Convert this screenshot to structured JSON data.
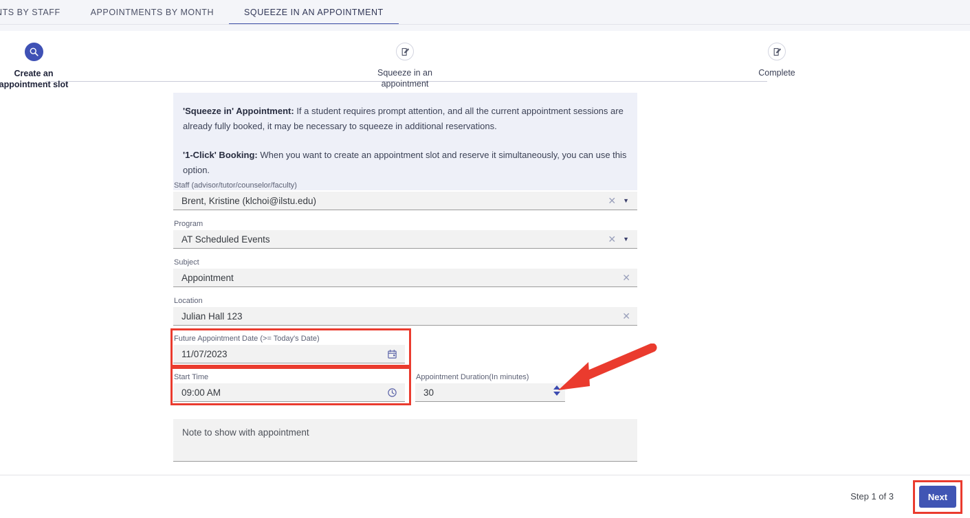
{
  "tabs": [
    {
      "label": "NTS BY STAFF",
      "active": false
    },
    {
      "label": "APPOINTMENTS BY MONTH",
      "active": false
    },
    {
      "label": "SQUEEZE IN AN APPOINTMENT",
      "active": true
    }
  ],
  "stepper": {
    "steps": [
      {
        "caption_line1": "Create an",
        "caption_line2": "appointment slot",
        "icon": "search-icon",
        "active": true
      },
      {
        "caption_line1": "Squeeze in an",
        "caption_line2": "appointment",
        "icon": "edit-document-icon",
        "active": false
      },
      {
        "caption_line1": "Complete",
        "caption_line2": "",
        "icon": "edit-document-icon",
        "active": false
      }
    ]
  },
  "info": {
    "para1_bold": "'Squeeze in' Appointment:",
    "para1_text": " If a student requires prompt attention, and all the current appointment sessions are already fully booked, it may be necessary to squeeze in additional reservations.",
    "para2_bold": "'1-Click' Booking:",
    "para2_text": " When you want to create an appointment slot and reserve it simultaneously, you can use this option."
  },
  "form": {
    "staff": {
      "label": "Staff (advisor/tutor/counselor/faculty)",
      "value": "Brent, Kristine (klchoi@ilstu.edu)"
    },
    "program": {
      "label": "Program",
      "value": "AT Scheduled Events"
    },
    "subject": {
      "label": "Subject",
      "value": "Appointment"
    },
    "location": {
      "label": "Location",
      "value": "Julian Hall 123"
    },
    "future_date": {
      "label": "Future Appointment Date (>= Today's Date)",
      "value": "11/07/2023"
    },
    "start_time": {
      "label": "Start Time",
      "value": "09:00 AM"
    },
    "duration": {
      "label": "Appointment Duration(In minutes)",
      "value": "30"
    },
    "note": {
      "placeholder": "Note to show with appointment",
      "value": ""
    }
  },
  "footer": {
    "step_indicator": "Step 1 of 3",
    "next_label": "Next"
  },
  "colors": {
    "accent": "#3f51b5",
    "button": "#4055b4",
    "annotation": "#ea3b2e",
    "info_bg": "#eef0f8",
    "tabbar_bg": "#f4f5f9",
    "input_bg": "#f2f2f2"
  }
}
